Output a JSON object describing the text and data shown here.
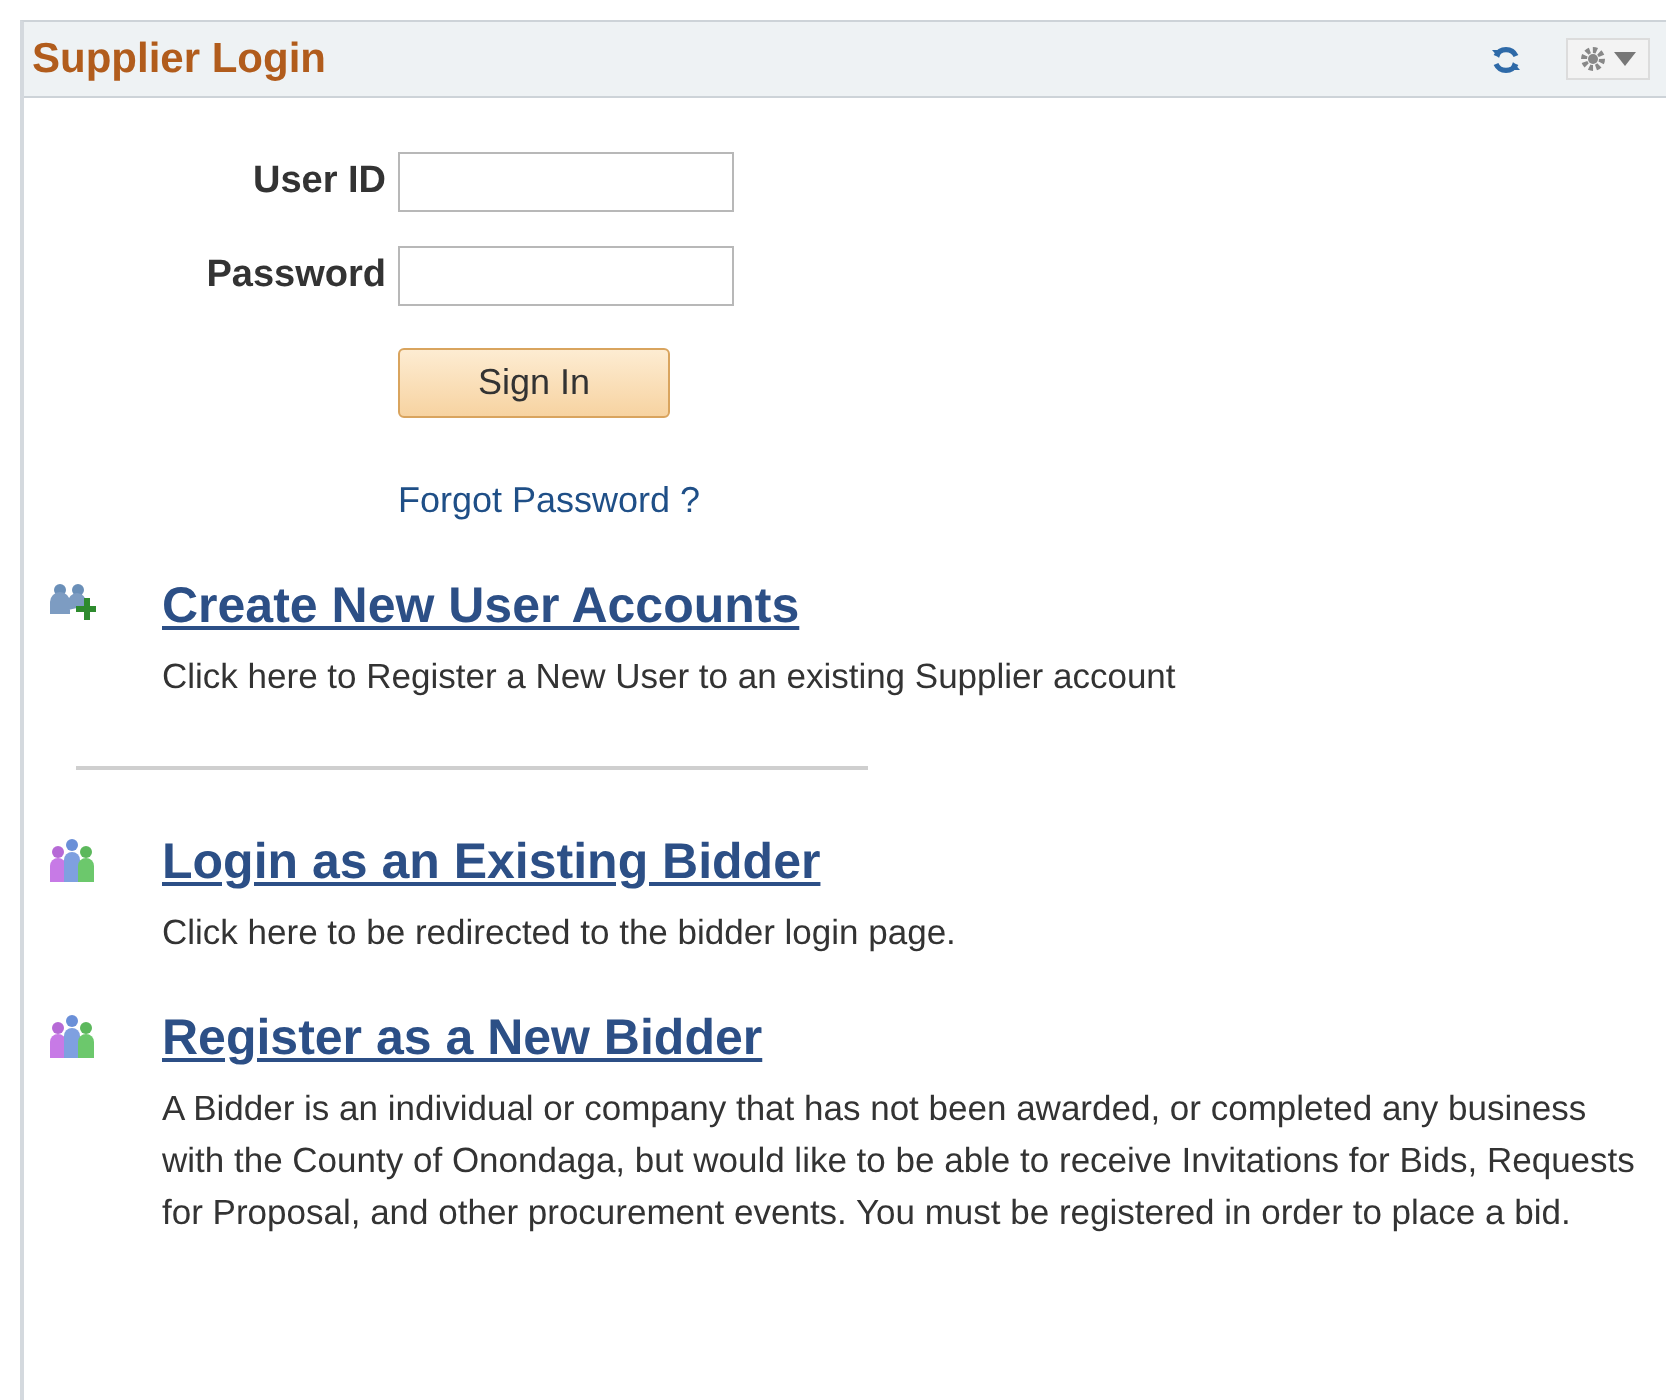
{
  "panel": {
    "title": "Supplier Login"
  },
  "login": {
    "fields": [
      {
        "label": "User ID"
      },
      {
        "label": "Password"
      }
    ],
    "button": "Sign In",
    "forgot_link": "Forgot Password ?"
  },
  "sections": [
    {
      "kind": "add-users",
      "title": "Create New User Accounts",
      "description": "Click here to Register a New User to an existing Supplier account",
      "divider_after": true
    },
    {
      "kind": "group",
      "title": "Login as an Existing Bidder",
      "description": "Click here to be redirected to the bidder login page.",
      "divider_after": false
    },
    {
      "kind": "group",
      "title": "Register as a New Bidder",
      "description": "A Bidder is an individual or company that has not been awarded, or completed any business with the County of Onondaga, but would like to be able to receive Invitations for Bids, Requests for Proposal, and other procurement events.  You must be registered in order to place a bid.",
      "divider_after": false
    }
  ]
}
